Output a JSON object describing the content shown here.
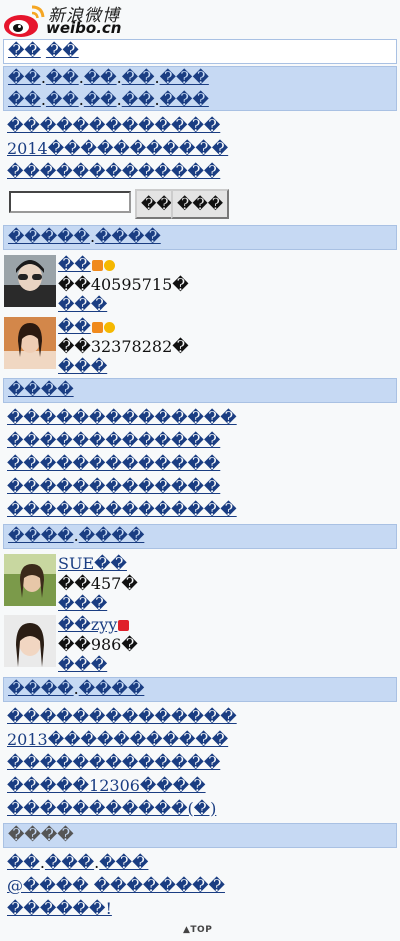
{
  "header": {
    "logo_cn": "新浪微博",
    "logo_en": "weibo.cn"
  },
  "topbar": {
    "link1": "��",
    "link2": "��"
  },
  "nav": {
    "row1": [
      "��",
      "��",
      "��",
      "��",
      "���"
    ],
    "row2": [
      "��",
      "��",
      "��",
      "��",
      "���"
    ],
    "sep": "."
  },
  "news": [
    "�������������",
    "2014�����������",
    "�������������"
  ],
  "search": {
    "value": "",
    "btn1": "��",
    "btn2": "���"
  },
  "section_famous": {
    "left": "�����",
    "sep": ".",
    "right": "����"
  },
  "famous": [
    {
      "name": "��",
      "fans": "��40595715�",
      "action": "���"
    },
    {
      "name": "��",
      "fans": "��32378282�",
      "action": "���"
    }
  ],
  "section_topics": {
    "title": "����"
  },
  "topics": [
    "��������������",
    "�������������",
    "�������������",
    "�������������",
    "��������������"
  ],
  "section_grass": {
    "left": "����",
    "sep": ".",
    "right": "����"
  },
  "grass": [
    {
      "name": "SUE��",
      "fans": "��457�",
      "action": "���"
    },
    {
      "name": "��zyy",
      "fans": "��986�",
      "action": "���"
    }
  ],
  "section_apps": {
    "left": "����",
    "sep": ".",
    "right": "����"
  },
  "apps": [
    "��������������",
    "2013�����������",
    "�������������",
    "�����12306����",
    "�����������(�)"
  ],
  "section_footer": {
    "title": "����"
  },
  "footer": {
    "row1": [
      "��",
      "���",
      "���"
    ],
    "row1_sep": ".",
    "row2": "@���� ��������",
    "row3": "������!"
  },
  "top_label": "TOP",
  "colors": {
    "bar_bg": "#c6d9f3",
    "bar_border": "#a9c1e3",
    "link": "#1a3d82",
    "page_bg": "#f7f9fa"
  }
}
